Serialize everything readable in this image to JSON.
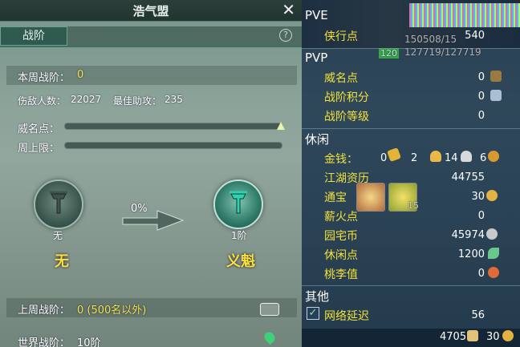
{
  "window": {
    "title": "浩气盟"
  },
  "tab": {
    "label": "战阶"
  },
  "this_week": {
    "label": "本周战阶：",
    "value": "0"
  },
  "stats": {
    "kills_label": "伤敌人数：",
    "kills": "22027",
    "assist_label": "最佳助攻：",
    "assist": "235"
  },
  "prestige": {
    "label": "威名点：",
    "cap_label": "周上限："
  },
  "progress": {
    "percent": "0%",
    "fraction": 0.0
  },
  "ranks": {
    "current": {
      "sub": "无",
      "name": "无"
    },
    "next": {
      "sub": "1阶",
      "name": "义魁"
    }
  },
  "last_week": {
    "label": "上周战阶：",
    "value": "0 (500名以外)"
  },
  "world": {
    "label": "世界战阶：",
    "value": "10阶"
  },
  "right": {
    "pve": {
      "title": "PVE",
      "items": [
        {
          "label": "侠行点",
          "value": "540"
        }
      ]
    },
    "pvp": {
      "title": "PVP",
      "items": [
        {
          "label": "威名点",
          "value": "0"
        },
        {
          "label": "战阶积分",
          "value": "0"
        },
        {
          "label": "战阶等级",
          "value": "0"
        }
      ]
    },
    "leisure": {
      "title": "休闲",
      "items": [
        {
          "label": "金钱：",
          "value": ""
        },
        {
          "label": "江湖资历",
          "value": "44755"
        },
        {
          "label": "通宝",
          "value": "30"
        },
        {
          "label": "薪火点",
          "value": "0"
        },
        {
          "label": "园宅币",
          "value": "45974"
        },
        {
          "label": "休闲点",
          "value": "1200"
        },
        {
          "label": "桃李值",
          "value": "0"
        }
      ],
      "money": {
        "a": "0",
        "b": "2",
        "c": "14",
        "d": "6"
      }
    },
    "other": {
      "title": "其他",
      "items": [
        {
          "label": "网络延迟",
          "value": "56"
        }
      ]
    },
    "footer": {
      "left": "4705",
      "right": "30"
    },
    "overlay": {
      "hp1": "150508/15",
      "hp2": "127719/127719",
      "lvl": "120",
      "thumb_num": "15"
    }
  },
  "colors": {
    "accent_yellow": "#f6e24a",
    "panel_teal": "#2f5a50",
    "right_bg": "#14324a"
  }
}
